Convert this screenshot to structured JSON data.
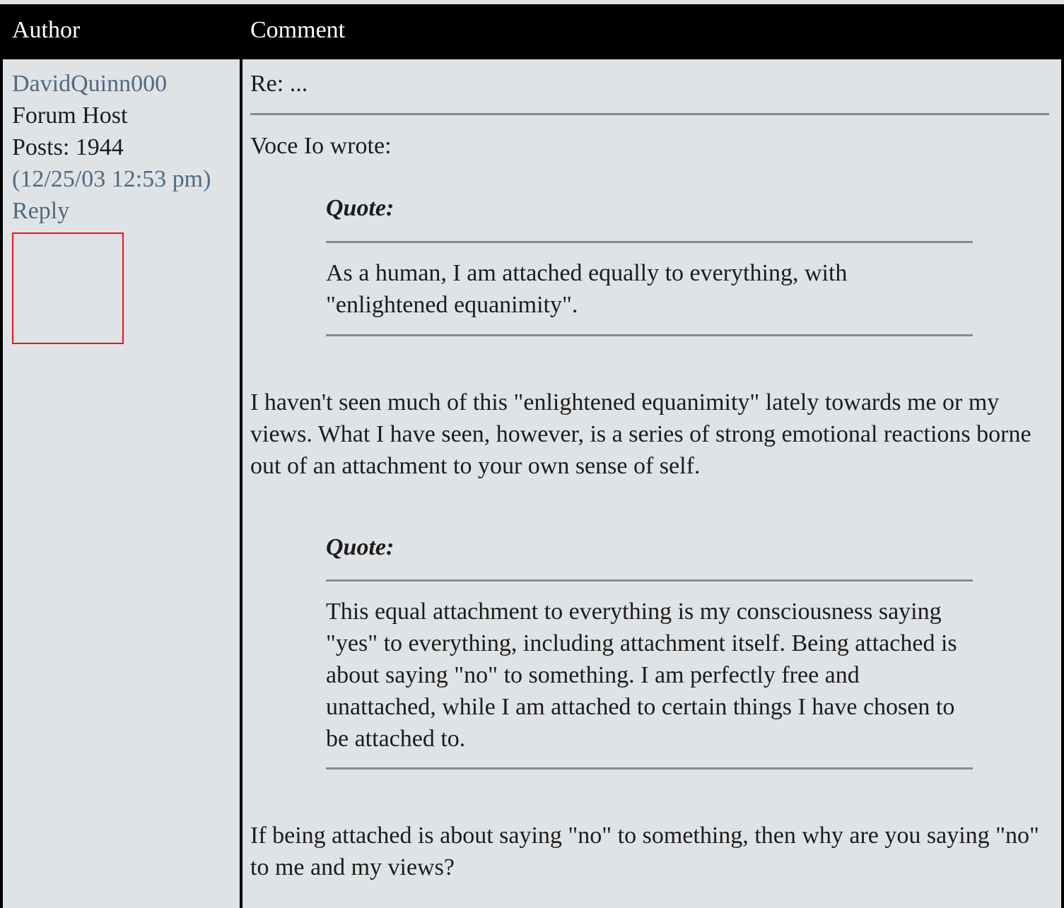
{
  "header": {
    "author_label": "Author",
    "comment_label": "Comment"
  },
  "author": {
    "name": "DavidQuinn000",
    "rank": "Forum Host",
    "posts": "Posts: 1944",
    "timestamp": "(12/25/03 12:53 pm)",
    "reply_label": "Reply"
  },
  "post": {
    "subject": "Re: ...",
    "wrote_line": "Voce Io wrote:",
    "quotes": [
      {
        "label": "Quote:",
        "text": "As a human, I am attached equally to everything, with \"enlightened equanimity\"."
      },
      {
        "label": "Quote:",
        "text": "This equal attachment to everything is my consciousness saying \"yes\" to everything, including attachment itself. Being attached is about saying \"no\" to something. I am perfectly free and unattached, while I am attached to certain things I have chosen to be attached to."
      }
    ],
    "paragraphs": [
      "I haven't seen much of this \"enlightened equanimity\" lately towards me or my views. What I have seen, however, is a series of strong emotional reactions borne out of an attachment to your own sense of self.",
      "If being attached is about saying \"no\" to something, then why are you saying \"no\" to me and my views?"
    ]
  },
  "colors": {
    "background": "#e0e3e6",
    "header_bg": "#000000",
    "link": "#4e6a82",
    "avatar_border": "#e8141b",
    "rule": "#8a8a8a"
  }
}
